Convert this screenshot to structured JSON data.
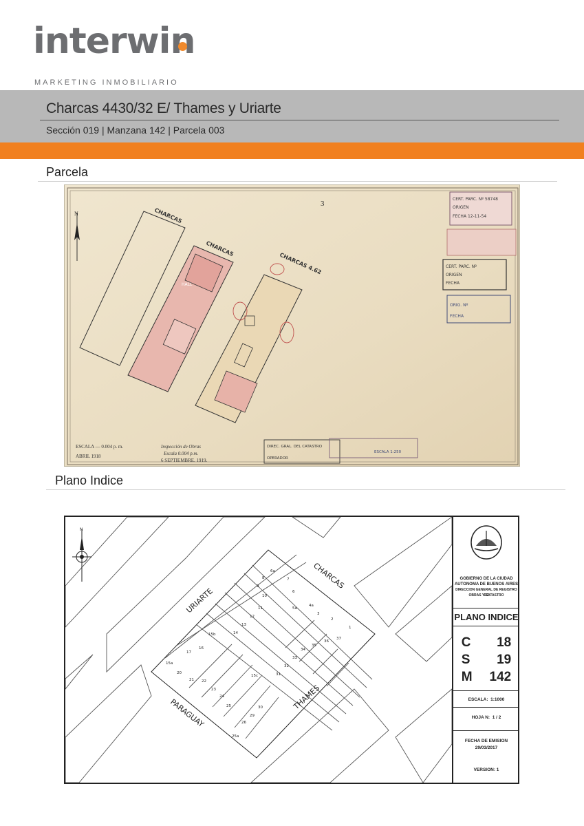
{
  "brand": {
    "name": "interwin",
    "tagline": "MARKETING INMOBILIARIO",
    "accent": "#f1801f",
    "band_color": "#b8b8b8"
  },
  "property": {
    "title": "Charcas 4430/32 E/ Thames y Uriarte",
    "subtitle": "Sección 019 | Manzana  142 | Parcela 003"
  },
  "sections": {
    "parcela": "Parcela",
    "plano_indice": "Plano Indice"
  },
  "plan": {
    "streets": [
      "CHARCAS",
      "CHARCAS",
      "CHARCAS 4.62"
    ],
    "hall": "HALL",
    "scale_text": "ESCALA — 0.004 p. m.",
    "date_text": "ABRIL 1918",
    "inspection": "Inspección de Obras",
    "inspection_scale": "Escala 0.004 p.m.",
    "inspection_date": "6 SEPTIEMBRE. 1919.",
    "stamp_catastro": "DIREC. GRAL. DEL CATASTRO",
    "stamp_operador": "OPERADOR",
    "stamp_scale": "ESCALA 1:250",
    "cert_lines": [
      "CERT. PARC. Nº 58748",
      "ORIGEN",
      "FECHA 12-11-54"
    ],
    "cert2_lines": [
      "CERT. PARC. Nº",
      "ORIGEN",
      "FECHA"
    ],
    "cert3_lines": [
      "ORIG. Nº",
      "FECHA"
    ],
    "page_mark": "3"
  },
  "indice": {
    "streets": [
      "URIARTE",
      "CHARCAS",
      "THAMES",
      "PARAGUAY"
    ],
    "north": "N",
    "lots": [
      "6a",
      "7",
      "8",
      "9",
      "10",
      "11",
      "12",
      "13",
      "14",
      "15b",
      "16",
      "17",
      "15a",
      "20",
      "21",
      "22",
      "23",
      "24",
      "25",
      "26",
      "25a",
      "29",
      "30",
      "31",
      "32",
      "33",
      "34",
      "35",
      "36",
      "37",
      "1",
      "2",
      "3",
      "4a",
      "5a",
      "6",
      "15c"
    ],
    "gov": [
      "GOBIERNO DE LA CIUDAD",
      "AUTONOMA DE BUENOS AIRES",
      "DIRECCION GENERAL DE REGISTRO DE",
      "OBRAS Y CATASTRO"
    ],
    "plan_title": "PLANO INDICE",
    "codes": [
      {
        "k": "C",
        "v": "18"
      },
      {
        "k": "S",
        "v": "19"
      },
      {
        "k": "M",
        "v": "142"
      }
    ],
    "escala_label": "ESCALA:",
    "escala_value": "1:1000",
    "hoja_label": "HOJA N:",
    "hoja_value": "1 / 2",
    "fecha_label": "FECHA DE EMISION",
    "fecha_value": "29/03/2017",
    "version": "VERSION: 1"
  }
}
